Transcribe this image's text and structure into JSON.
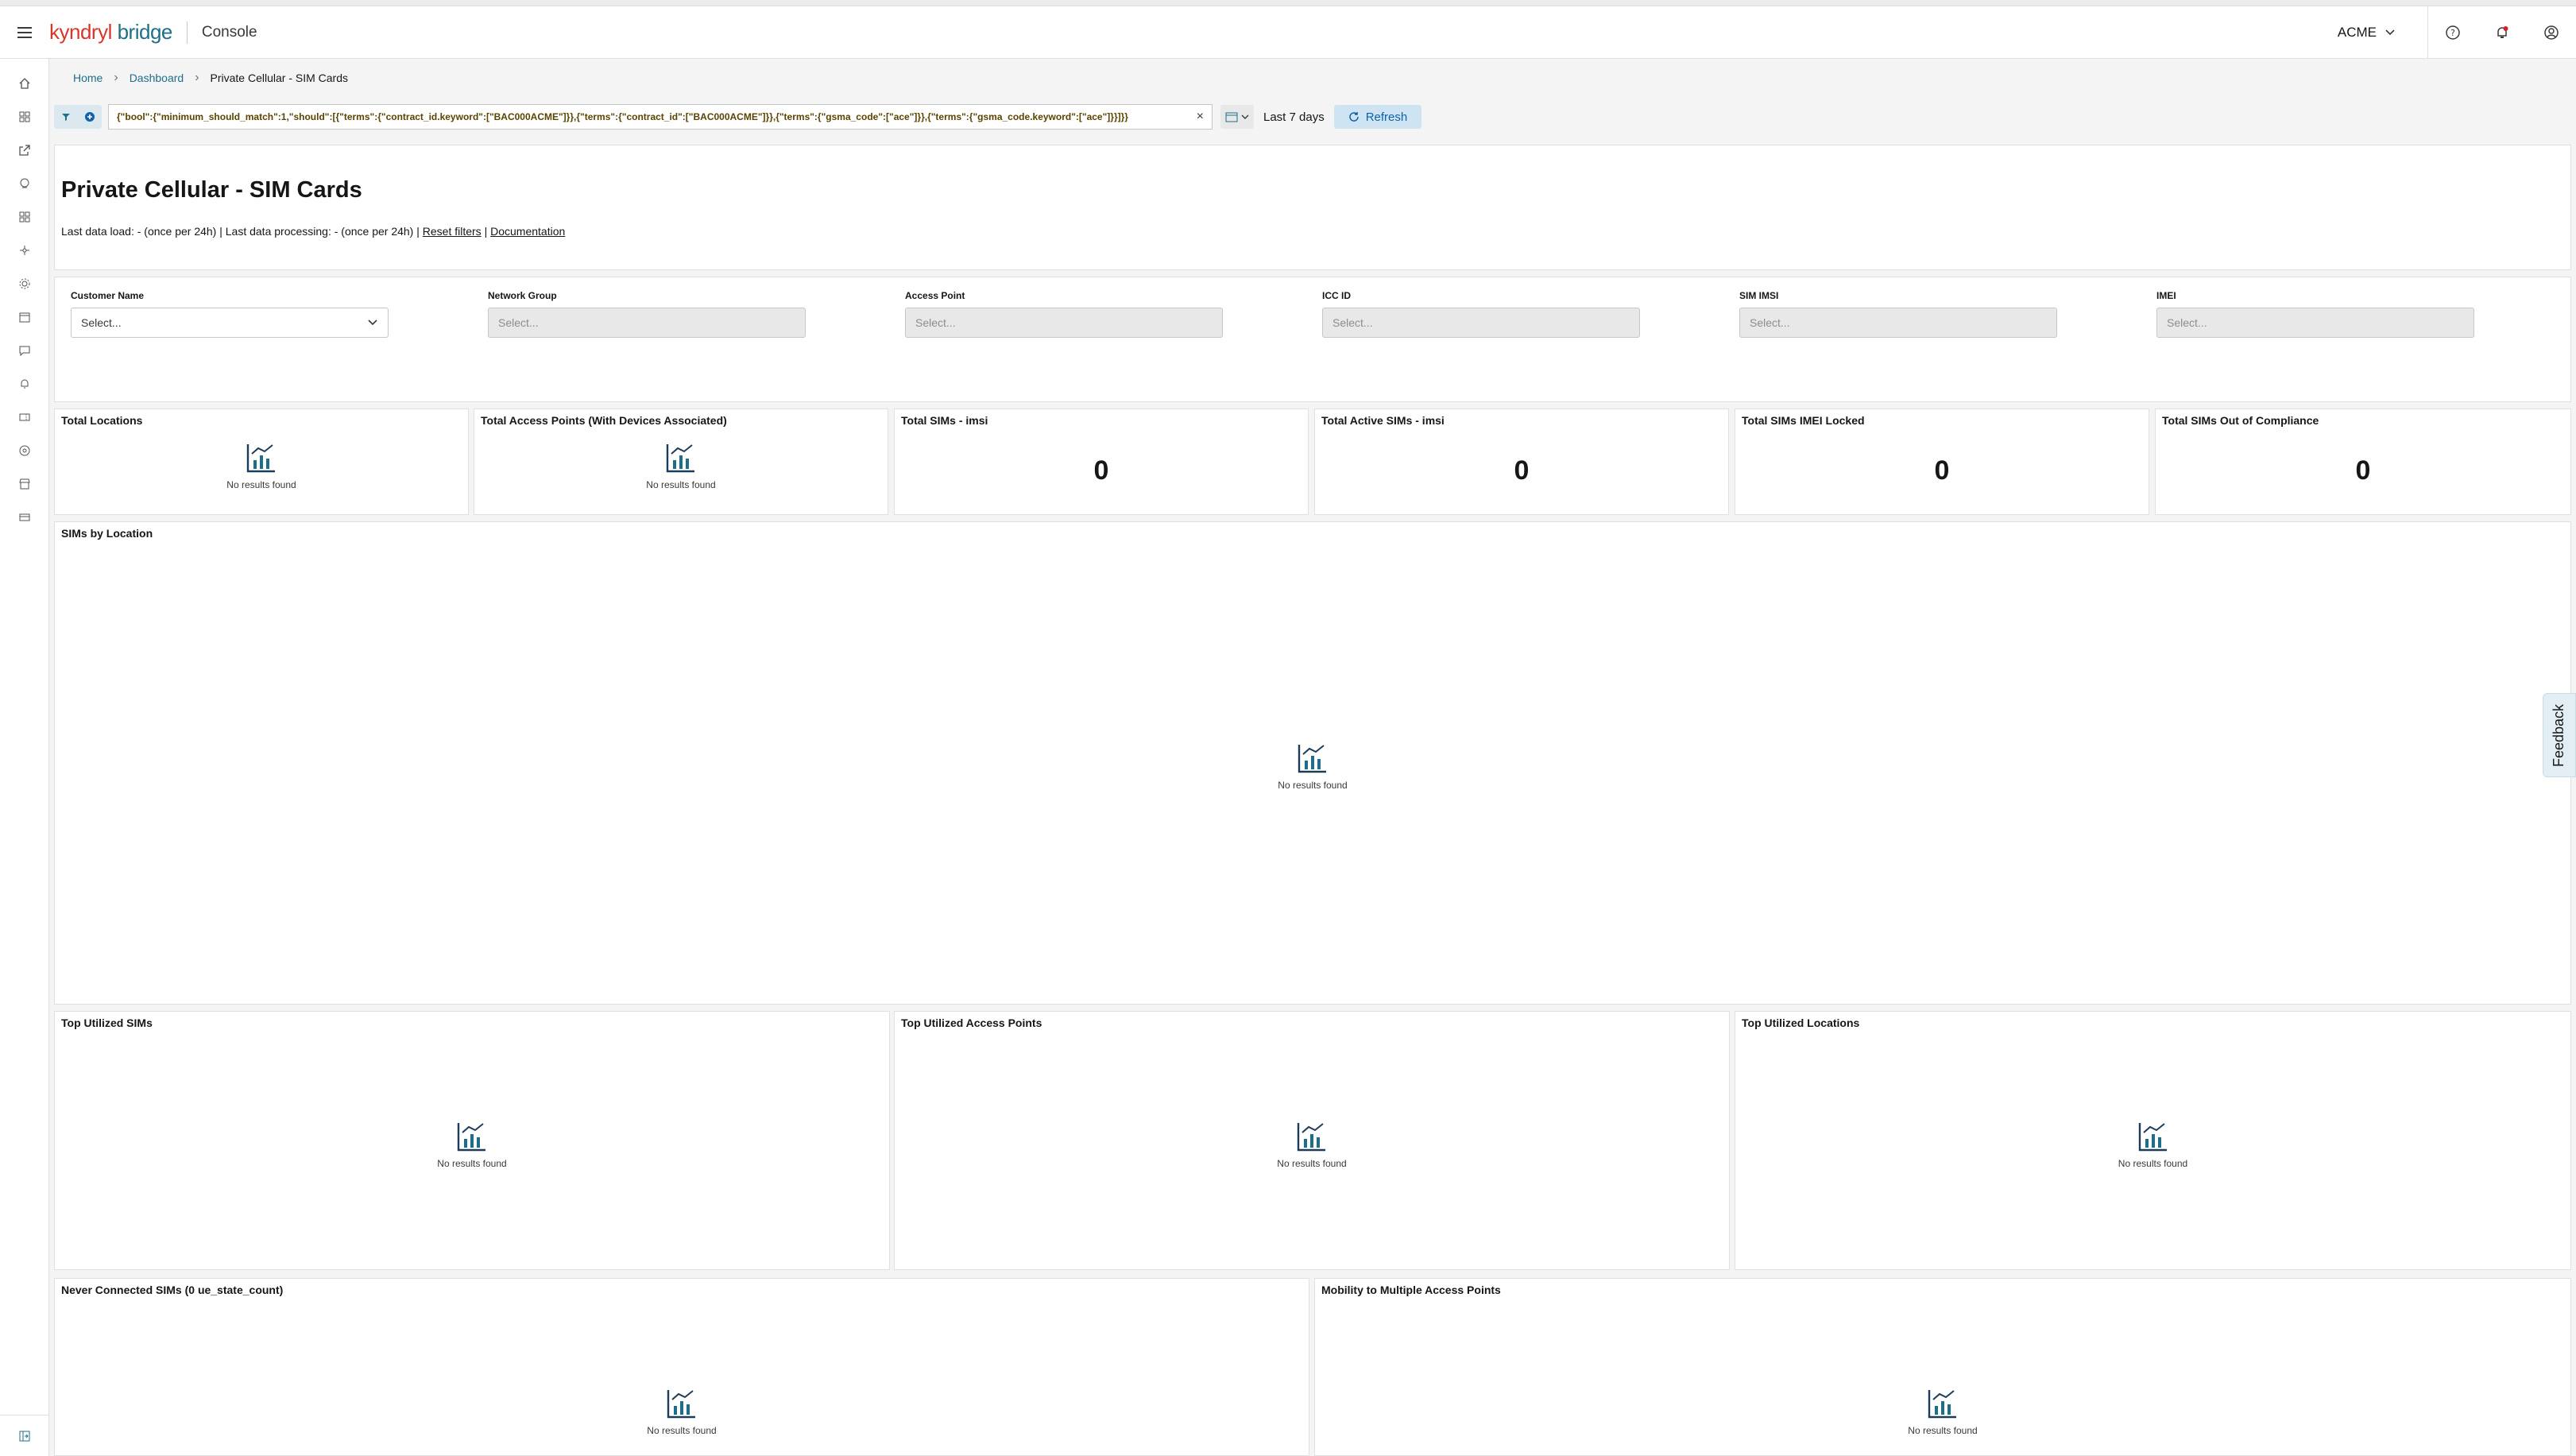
{
  "header": {
    "logo_kyndryl": "kyndryl",
    "logo_bridge": " bridge",
    "app_name": "Console",
    "account": "ACME"
  },
  "breadcrumb": {
    "home": "Home",
    "dashboard": "Dashboard",
    "current": "Private Cellular - SIM Cards"
  },
  "filterbar": {
    "query": "{\"bool\":{\"minimum_should_match\":1,\"should\":[{\"terms\":{\"contract_id.keyword\":[\"BAC000ACME\"]}},{\"terms\":{\"contract_id\":[\"BAC000ACME\"]}},{\"terms\":{\"gsma_code\":[\"ace\"]}},{\"terms\":{\"gsma_code.keyword\":[\"ace\"]}}]}}",
    "date_range": "Last 7 days",
    "refresh_label": "Refresh"
  },
  "page": {
    "title": "Private Cellular - SIM Cards",
    "info": "Last data load: - (once per 24h) | Last data processing: - (once per 24h) |",
    "reset_filters": "Reset filters",
    "pipe": "|",
    "documentation": "Documentation"
  },
  "filters": [
    {
      "label": "Customer Name",
      "placeholder": "Select..."
    },
    {
      "label": "Network Group",
      "placeholder": "Select..."
    },
    {
      "label": "Access Point",
      "placeholder": "Select..."
    },
    {
      "label": "ICC ID",
      "placeholder": "Select..."
    },
    {
      "label": "SIM IMSI",
      "placeholder": "Select..."
    },
    {
      "label": "IMEI",
      "placeholder": "Select..."
    }
  ],
  "empty_text": "No results found",
  "metrics": [
    {
      "title": "Total Locations"
    },
    {
      "title": "Total Access Points (With Devices Associated)"
    },
    {
      "title": "Total SIMs - imsi",
      "value": "0"
    },
    {
      "title": "Total Active SIMs - imsi",
      "value": "0"
    },
    {
      "title": "Total SIMs IMEI Locked",
      "value": "0"
    },
    {
      "title": "Total SIMs Out of Compliance",
      "value": "0"
    }
  ],
  "charts": {
    "sims_by_location": "SIMs by Location",
    "top_sims": "Top Utilized SIMs",
    "top_access_points": "Top Utilized Access Points",
    "top_locations": "Top Utilized Locations",
    "never_connected": "Never Connected SIMs (0 ue_state_count)",
    "mobility": "Mobility to Multiple Access Points"
  },
  "feedback": "Feedback"
}
